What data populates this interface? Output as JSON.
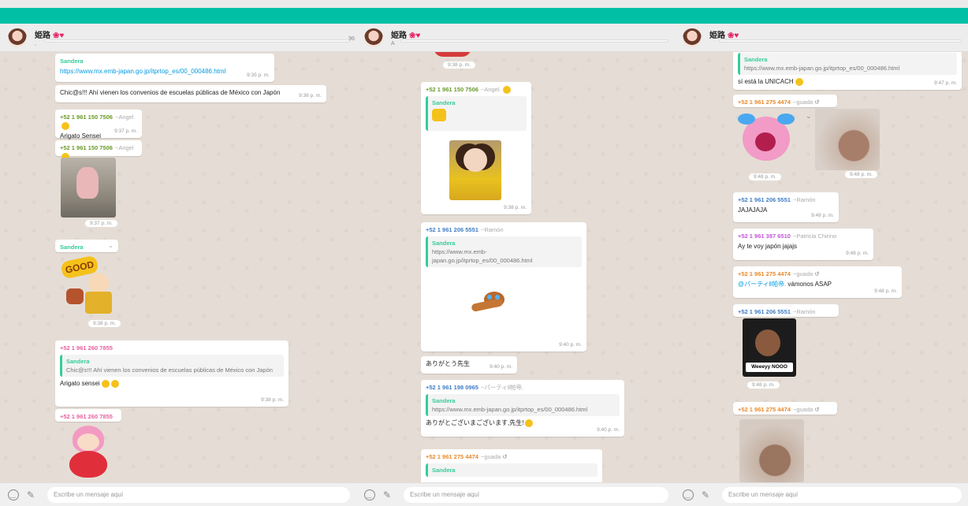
{
  "chat": {
    "title": "姫路",
    "hearts": "❀♥",
    "input_placeholder": "Escribe un mensaje aquí",
    "header_num": "96"
  },
  "p1": {
    "m1_sender": "Sandera",
    "m1_link": "https://www.mx.emb-japan.go.jp/itprtop_es/00_000486.html",
    "m1_time": "9:35 p. m.",
    "m2_text": "Chic@s!!! Ahí vienen los convenios de escuelas públicas de México con Japón",
    "m2_time": "9:36 p. m.",
    "m3_sender": "+52 1 961 150 7506",
    "m3_alias": "~Angel",
    "m3_text": "Arigato Sensei",
    "m3_time": "9:37 p. m.",
    "m4_sender": "+52 1 961 150 7506",
    "m4_alias": "~Angel",
    "m4_time": "9:37 p. m.",
    "m5_sender": "Sandera",
    "m5_time": "9:38 p. m.",
    "m5_sticker": "GOOD",
    "m6_sender": "+52 1 961 260 7855",
    "m6_qname": "Sandera",
    "m6_qtext": "Chic@s!!! Ahí vienen los convenios de escuelas públicas de México con Japón",
    "m6_text": "Arigato sensei",
    "m6_time": "9:38 p. m.",
    "m7_sender": "+52 1 961 260 7855"
  },
  "p2": {
    "t0": "9:38 p. m.",
    "m1_sender": "+52 1 961 150 7506",
    "m1_alias": "~Angel.",
    "m1_qname": "Sandera",
    "m1_time": "9:38 p. m.",
    "m2_sender": "+52 1 961 206 5551",
    "m2_alias": "~Ramón",
    "m2_qname": "Sandera",
    "m2_qtext": "https://www.mx.emb-japan.go.jp/itprtop_es/00_000486.html",
    "m2_time": "9:40 p. m.",
    "m3_text": "ありがとう先生",
    "m3_time": "9:40 p. m.",
    "m4_sender": "+52 1 961 198 0965",
    "m4_alias": "~パーティ‖帕帝.",
    "m4_qname": "Sandera",
    "m4_qtext": "https://www.mx.emb-japan.go.jp/itprtop_es/00_000486.html",
    "m4_text": "ありがとございまございます,先生!",
    "m4_time": "9:40 p. m.",
    "m5_sender": "+52 1 961 275 4474",
    "m5_alias": "~guada",
    "m5_qname": "Sandera"
  },
  "p3": {
    "m1_qname": "Sandera",
    "m1_qtext": "https://www.mx.emb-japan.go.jp/itprtop_es/00_000486.html",
    "m1_text": "sí está la UNICACH",
    "m1_time": "9:47 p. m.",
    "m2_sender": "+52 1 961 275 4474",
    "m2_alias": "~guada",
    "m2_time_a": "9:48 p. m.",
    "m2_time_b": "9:48 p. m.",
    "m3_sender": "+52 1 961 206 5551",
    "m3_alias": "~Ramón",
    "m3_text": "JAJAJAJA",
    "m3_time": "9:48 p. m.",
    "m4_sender": "+52 1 961 387 6510",
    "m4_alias": "~Patricia Chirino",
    "m4_text": "Ay te voy japón jajajs",
    "m4_time": "9:48 p. m.",
    "m5_sender": "+52 1 961 275 4474",
    "m5_alias": "~guada",
    "m5_mention": "@パーティ‖帕帝.",
    "m5_text": "vámonos ASAP",
    "m5_time": "9:48 p. m.",
    "m6_sender": "+52 1 961 206 5551",
    "m6_alias": "~Ramón",
    "m6_caption": "Weeeyy NOOO",
    "m6_time": "9:48 p. m.",
    "m7_sender": "+52 1 961 275 4474",
    "m7_alias": "~guada"
  },
  "colors": {
    "teal": "#00bfa5",
    "green_sender": "#6a9a2a",
    "pink_sender": "#e8619f",
    "blue_sender": "#3f7dc6",
    "orange_sender": "#e98a2c",
    "teal_sender": "#35cd96",
    "purple_sender": "#c256d6"
  }
}
